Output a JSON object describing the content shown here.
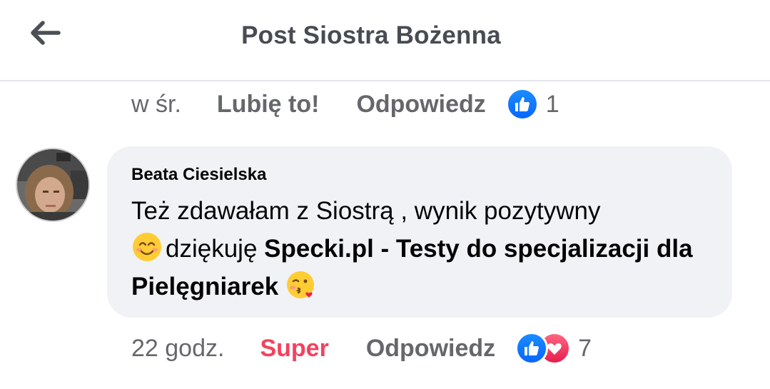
{
  "header": {
    "title": "Post Siostra Bożenna",
    "back_icon": "arrow-left-icon"
  },
  "previous_comment": {
    "time": "w śr.",
    "like_label": "Lubię to!",
    "reply_label": "Odpowiedz",
    "reaction_count": "1",
    "reactions": [
      "like"
    ]
  },
  "comment": {
    "author": "Beata Ciesielska",
    "text_part1": "Też zdawałam z Siostrą , wynik pozytywny ",
    "text_part2": "dziękuję ",
    "mention": "Specki.pl - Testy do specjalizacji dla Pielęgniarek",
    "emojis": [
      "smiling-face-icon",
      "face-blowing-kiss-icon"
    ],
    "time": "22 godz.",
    "reaction_label": "Super",
    "reply_label": "Odpowiedz",
    "reaction_count": "7",
    "reactions": [
      "like",
      "love"
    ]
  },
  "colors": {
    "like_blue": "#0866ff",
    "love_red": "#f3425f",
    "bubble_bg": "#f0f2f5",
    "meta_gray": "#65676b"
  }
}
